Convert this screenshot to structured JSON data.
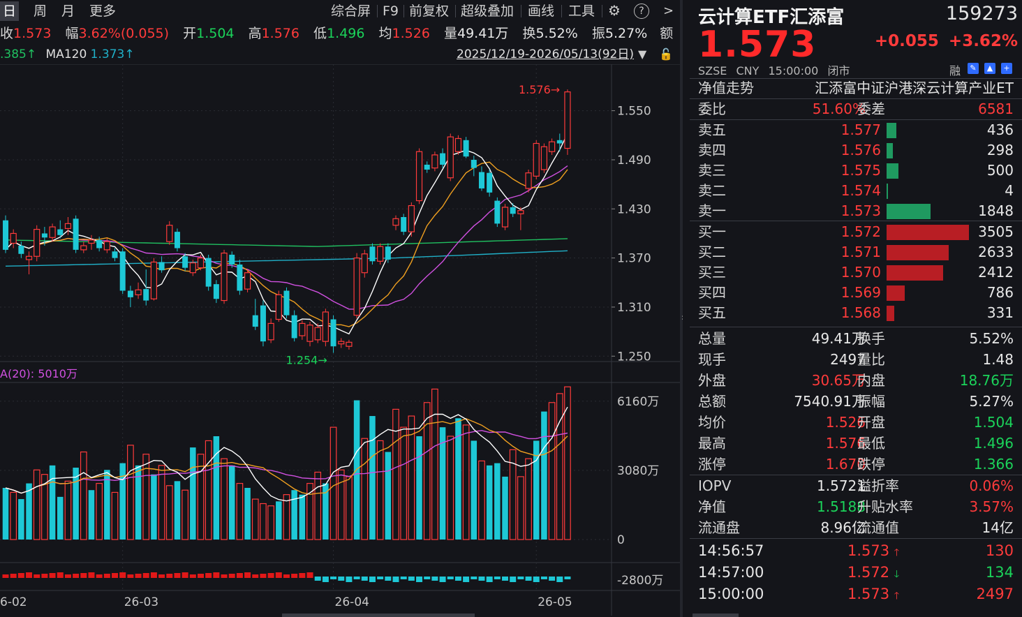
{
  "toolbar": {
    "periods": [
      "日",
      "周",
      "月",
      "更多"
    ],
    "tools": [
      "综合屏",
      "F9",
      "前复权",
      "超级叠加",
      "画线",
      "工具"
    ],
    "help_icon": "?",
    "next_icon": ">"
  },
  "info": {
    "close_label": "收",
    "close_value": "1.573",
    "range_label": "幅",
    "range_value": "3.62%(0.055)",
    "open_label": "开",
    "open_value": "1.504",
    "high_label": "高",
    "high_value": "1.576",
    "low_label": "低",
    "low_value": "1.496",
    "avg_label": "均",
    "avg_value": "1.526",
    "vol_label": "量",
    "vol_value": "49.41万",
    "turnover_label": "换",
    "turnover_value": "5.52%",
    "amp_label": "振",
    "amp_value": "5.27%",
    "extra_label": "额"
  },
  "ma_line": {
    "ma60_text": ".385↑",
    "ma120_label": "MA120",
    "ma120_value": "1.373↑"
  },
  "date_range": "2025/12/19-2026/05/13(92日)",
  "vol_ma_label": "A(20): 5010万",
  "chart_data": {
    "type": "candlestick",
    "price_axis_ticks": [
      "1.550",
      "1.490",
      "1.430",
      "1.370",
      "1.310",
      "1.250"
    ],
    "price_ylim": [
      1.24,
      1.6
    ],
    "volume_axis_ticks": [
      "6160万",
      "3080万",
      "0"
    ],
    "macd_axis_tick": "-2800万",
    "x_ticks": [
      "6-02",
      "26-03",
      "26-04",
      "26-05"
    ],
    "annotations": {
      "high": "1.576",
      "low": "1.254"
    },
    "candles": [
      [
        1.416,
        1.38,
        1.376,
        1.422
      ],
      [
        1.388,
        1.4,
        1.382,
        1.405
      ],
      [
        1.385,
        1.375,
        1.37,
        1.39
      ],
      [
        1.368,
        1.372,
        1.35,
        1.378
      ],
      [
        1.372,
        1.405,
        1.366,
        1.41
      ],
      [
        1.4,
        1.395,
        1.385,
        1.408
      ],
      [
        1.395,
        1.408,
        1.39,
        1.412
      ],
      [
        1.405,
        1.398,
        1.394,
        1.416
      ],
      [
        1.406,
        1.412,
        1.398,
        1.42
      ],
      [
        1.418,
        1.38,
        1.376,
        1.422
      ],
      [
        1.38,
        1.385,
        1.376,
        1.39
      ],
      [
        1.388,
        1.392,
        1.38,
        1.398
      ],
      [
        1.392,
        1.382,
        1.378,
        1.396
      ],
      [
        1.38,
        1.39,
        1.376,
        1.394
      ],
      [
        1.378,
        1.37,
        1.366,
        1.382
      ],
      [
        1.378,
        1.33,
        1.326,
        1.382
      ],
      [
        1.33,
        1.322,
        1.31,
        1.336
      ],
      [
        1.325,
        1.331,
        1.32,
        1.34
      ],
      [
        1.332,
        1.318,
        1.312,
        1.356
      ],
      [
        1.32,
        1.365,
        1.318,
        1.37
      ],
      [
        1.365,
        1.355,
        1.352,
        1.372
      ],
      [
        1.39,
        1.41,
        1.386,
        1.415
      ],
      [
        1.402,
        1.382,
        1.378,
        1.406
      ],
      [
        1.372,
        1.358,
        1.354,
        1.376
      ],
      [
        1.352,
        1.364,
        1.348,
        1.368
      ],
      [
        1.358,
        1.37,
        1.355,
        1.374
      ],
      [
        1.37,
        1.335,
        1.33,
        1.374
      ],
      [
        1.338,
        1.32,
        1.315,
        1.343
      ],
      [
        1.318,
        1.376,
        1.314,
        1.38
      ],
      [
        1.374,
        1.362,
        1.358,
        1.378
      ],
      [
        1.362,
        1.33,
        1.325,
        1.368
      ],
      [
        1.332,
        1.352,
        1.328,
        1.356
      ],
      [
        1.3,
        1.286,
        1.282,
        1.32
      ],
      [
        1.312,
        1.268,
        1.262,
        1.318
      ],
      [
        1.27,
        1.29,
        1.266,
        1.296
      ],
      [
        1.295,
        1.325,
        1.292,
        1.33
      ],
      [
        1.33,
        1.3,
        1.296,
        1.334
      ],
      [
        1.3,
        1.272,
        1.268,
        1.306
      ],
      [
        1.275,
        1.29,
        1.27,
        1.294
      ],
      [
        1.268,
        1.288,
        1.262,
        1.292
      ],
      [
        1.27,
        1.285,
        1.266,
        1.29
      ],
      [
        1.268,
        1.304,
        1.262,
        1.308
      ],
      [
        1.295,
        1.262,
        1.254,
        1.3
      ],
      [
        1.265,
        1.268,
        1.26,
        1.272
      ],
      [
        1.262,
        1.267,
        1.258,
        1.27
      ],
      [
        1.3,
        1.37,
        1.296,
        1.376
      ],
      [
        1.352,
        1.375,
        1.346,
        1.38
      ],
      [
        1.384,
        1.366,
        1.362,
        1.388
      ],
      [
        1.366,
        1.384,
        1.362,
        1.388
      ],
      [
        1.384,
        1.368,
        1.364,
        1.388
      ],
      [
        1.41,
        1.418,
        1.404,
        1.422
      ],
      [
        1.42,
        1.402,
        1.398,
        1.424
      ],
      [
        1.402,
        1.434,
        1.396,
        1.438
      ],
      [
        1.44,
        1.5,
        1.436,
        1.504
      ],
      [
        1.484,
        1.478,
        1.474,
        1.488
      ],
      [
        1.48,
        1.496,
        1.476,
        1.5
      ],
      [
        1.498,
        1.484,
        1.48,
        1.504
      ],
      [
        1.468,
        1.518,
        1.464,
        1.522
      ],
      [
        1.5,
        1.516,
        1.496,
        1.52
      ],
      [
        1.514,
        1.494,
        1.492,
        1.518
      ],
      [
        1.49,
        1.48,
        1.47,
        1.495
      ],
      [
        1.475,
        1.455,
        1.452,
        1.482
      ],
      [
        1.474,
        1.45,
        1.445,
        1.478
      ],
      [
        1.44,
        1.412,
        1.408,
        1.444
      ],
      [
        1.408,
        1.432,
        1.404,
        1.436
      ],
      [
        1.432,
        1.424,
        1.42,
        1.437
      ],
      [
        1.424,
        1.428,
        1.404,
        1.432
      ],
      [
        1.455,
        1.474,
        1.45,
        1.478
      ],
      [
        1.47,
        1.51,
        1.466,
        1.514
      ],
      [
        1.478,
        1.506,
        1.474,
        1.51
      ],
      [
        1.5,
        1.512,
        1.496,
        1.516
      ],
      [
        1.514,
        1.51,
        1.5,
        1.522
      ],
      [
        1.504,
        1.573,
        1.496,
        1.576
      ]
    ],
    "volumes": [
      [
        2300,
        "dn"
      ],
      [
        2100,
        "up"
      ],
      [
        1800,
        "dn"
      ],
      [
        2500,
        "dn"
      ],
      [
        3100,
        "up"
      ],
      [
        2900,
        "up"
      ],
      [
        3300,
        "dn"
      ],
      [
        1900,
        "dn"
      ],
      [
        2600,
        "up"
      ],
      [
        3200,
        "dn"
      ],
      [
        3900,
        "up"
      ],
      [
        2200,
        "dn"
      ],
      [
        2500,
        "up"
      ],
      [
        3100,
        "dn"
      ],
      [
        2100,
        "up"
      ],
      [
        3400,
        "dn"
      ],
      [
        4200,
        "up"
      ],
      [
        3300,
        "dn"
      ],
      [
        3800,
        "up"
      ],
      [
        2900,
        "dn"
      ],
      [
        3300,
        "up"
      ],
      [
        2400,
        "up"
      ],
      [
        2600,
        "dn"
      ],
      [
        2200,
        "up"
      ],
      [
        4100,
        "dn"
      ],
      [
        3800,
        "up"
      ],
      [
        4400,
        "up"
      ],
      [
        4600,
        "dn"
      ],
      [
        3600,
        "up"
      ],
      [
        3300,
        "dn"
      ],
      [
        2500,
        "up"
      ],
      [
        2300,
        "dn"
      ],
      [
        1800,
        "up"
      ],
      [
        1600,
        "up"
      ],
      [
        1500,
        "up"
      ],
      [
        1700,
        "dn"
      ],
      [
        2000,
        "up"
      ],
      [
        2200,
        "dn"
      ],
      [
        2000,
        "dn"
      ],
      [
        2500,
        "up"
      ],
      [
        3000,
        "up"
      ],
      [
        2500,
        "dn"
      ],
      [
        5000,
        "up"
      ],
      [
        3100,
        "up"
      ],
      [
        2800,
        "up"
      ],
      [
        6200,
        "dn"
      ],
      [
        4500,
        "up"
      ],
      [
        5500,
        "dn"
      ],
      [
        4400,
        "up"
      ],
      [
        3900,
        "dn"
      ],
      [
        5800,
        "up"
      ],
      [
        5000,
        "up"
      ],
      [
        5500,
        "up"
      ],
      [
        4600,
        "dn"
      ],
      [
        6100,
        "up"
      ],
      [
        6700,
        "up"
      ],
      [
        5000,
        "dn"
      ],
      [
        4600,
        "up"
      ],
      [
        5400,
        "dn"
      ],
      [
        5100,
        "up"
      ],
      [
        4400,
        "dn"
      ],
      [
        3500,
        "up"
      ],
      [
        3300,
        "dn"
      ],
      [
        3400,
        "dn"
      ],
      [
        2800,
        "dn"
      ],
      [
        4000,
        "up"
      ],
      [
        2800,
        "up"
      ],
      [
        3600,
        "up"
      ],
      [
        4400,
        "dn"
      ],
      [
        5700,
        "dn"
      ],
      [
        6100,
        "up"
      ],
      [
        6500,
        "up"
      ],
      [
        6800,
        "up"
      ]
    ]
  },
  "quote": {
    "name": "云计算ETF汇添富",
    "code": "159273",
    "price": "1.573",
    "change": "+0.055",
    "change_pct": "+3.62%",
    "exchange": "SZSE",
    "currency": "CNY",
    "time": "15:00:00",
    "status": "闭市",
    "rong": "融",
    "nav_trend_label": "净值走势",
    "fund_fullname": "汇添富中证沪港深云计算产业ET",
    "weibi_label": "委比",
    "weibi_value": "51.60%",
    "weicha_label": "委差",
    "weicha_value": "6581"
  },
  "orderbook": {
    "asks": [
      {
        "label": "卖五",
        "price": "1.577",
        "volume": "436",
        "bar": 0.12
      },
      {
        "label": "卖四",
        "price": "1.576",
        "volume": "298",
        "bar": 0.08
      },
      {
        "label": "卖三",
        "price": "1.575",
        "volume": "500",
        "bar": 0.14
      },
      {
        "label": "卖二",
        "price": "1.574",
        "volume": "4",
        "bar": 0.01
      },
      {
        "label": "卖一",
        "price": "1.573",
        "volume": "1848",
        "bar": 0.53
      }
    ],
    "bids": [
      {
        "label": "买一",
        "price": "1.572",
        "volume": "3505",
        "bar": 1.0
      },
      {
        "label": "买二",
        "price": "1.571",
        "volume": "2633",
        "bar": 0.75
      },
      {
        "label": "买三",
        "price": "1.570",
        "volume": "2412",
        "bar": 0.69
      },
      {
        "label": "买四",
        "price": "1.569",
        "volume": "786",
        "bar": 0.22
      },
      {
        "label": "买五",
        "price": "1.568",
        "volume": "331",
        "bar": 0.09
      }
    ]
  },
  "stats": [
    {
      "l1": "总量",
      "v1": "49.41万",
      "c1": "wh",
      "l2": "换手",
      "v2": "5.52%",
      "c2": "wh"
    },
    {
      "l1": "现手",
      "v1": "2497",
      "c1": "wh",
      "l2": "量比",
      "v2": "1.48",
      "c2": "wh"
    },
    {
      "l1": "外盘",
      "v1": "30.65万",
      "c1": "up",
      "l2": "内盘",
      "v2": "18.76万",
      "c2": "dn"
    },
    {
      "l1": "总额",
      "v1": "7540.91万",
      "c1": "wh",
      "l2": "振幅",
      "v2": "5.27%",
      "c2": "wh"
    },
    {
      "l1": "均价",
      "v1": "1.526",
      "c1": "up",
      "l2": "开盘",
      "v2": "1.504",
      "c2": "dn"
    },
    {
      "l1": "最高",
      "v1": "1.576",
      "c1": "up",
      "l2": "最低",
      "v2": "1.496",
      "c2": "dn"
    },
    {
      "l1": "涨停",
      "v1": "1.670",
      "c1": "up",
      "l2": "跌停",
      "v2": "1.366",
      "c2": "dn"
    }
  ],
  "stats2": [
    {
      "l1": "IOPV",
      "v1": "1.5721",
      "c1": "wh",
      "l2": "溢折率",
      "v2": "0.06%",
      "c2": "up"
    },
    {
      "l1": "净值",
      "v1": "1.5188",
      "c1": "dn",
      "l2": "升贴水率",
      "v2": "3.57%",
      "c2": "up"
    },
    {
      "l1": "流通盘",
      "v1": "8.96亿",
      "c1": "wh",
      "l2": "流通值",
      "v2": "14亿",
      "c2": "wh"
    }
  ],
  "ticks": [
    {
      "time": "14:56:57",
      "price": "1.573",
      "arrow": "🡑",
      "dir": "up",
      "qty": "130"
    },
    {
      "time": "14:57:00",
      "price": "1.572",
      "arrow": "🡓",
      "dir": "dn",
      "qty": "134"
    },
    {
      "time": "15:00:00",
      "price": "1.573",
      "arrow": "🡑",
      "dir": "up",
      "qty": "2497"
    }
  ],
  "colors": {
    "up": "#ff3b3b",
    "down": "#1bd35a",
    "cyan": "#1ec8d6",
    "ma5": "#ffffff",
    "ma10": "#f0a020",
    "ma20": "#d050e0",
    "ma60": "#20c060",
    "ma120": "#20b0c8"
  }
}
